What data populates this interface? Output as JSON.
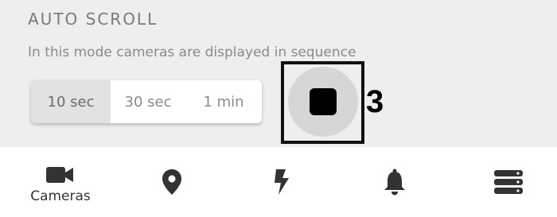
{
  "section": {
    "title": "AUTO SCROLL",
    "description": "In this mode cameras are displayed in sequence"
  },
  "interval_options": [
    {
      "label": "10 sec",
      "selected": true
    },
    {
      "label": "30 sec",
      "selected": false
    },
    {
      "label": "1 min",
      "selected": false
    }
  ],
  "stop_button": {
    "icon": "stop-icon"
  },
  "callout": {
    "number": "3"
  },
  "tabbar": {
    "items": [
      {
        "label": "Cameras",
        "icon": "video-camera-icon"
      },
      {
        "label": "",
        "icon": "location-pin-icon"
      },
      {
        "label": "",
        "icon": "lightning-icon"
      },
      {
        "label": "",
        "icon": "bell-icon"
      },
      {
        "label": "",
        "icon": "server-stack-icon"
      }
    ]
  },
  "colors": {
    "panel_bg": "#eeeeee",
    "segment_active_bg": "#e2e2e2",
    "stop_button_bg": "#d6d6d6",
    "icon_color": "#333333",
    "callout_border": "#111111"
  }
}
